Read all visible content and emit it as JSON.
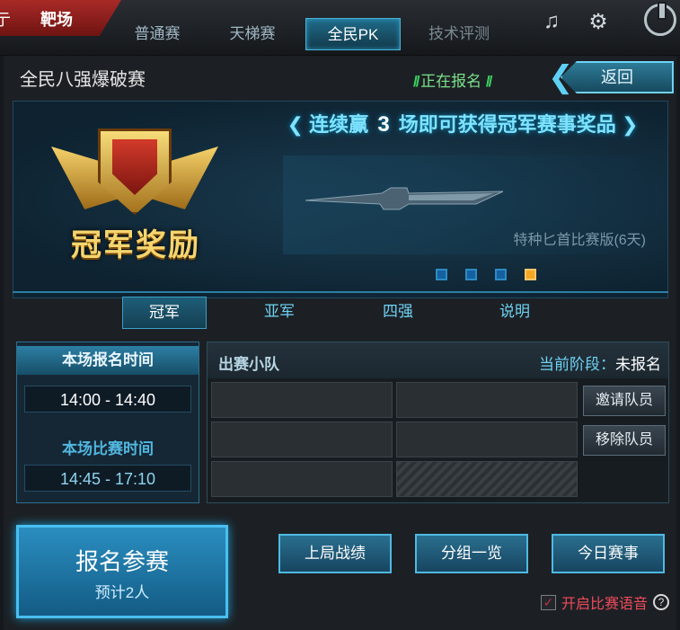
{
  "topbar": {
    "left_tab_partial": "亍",
    "red_tab": "靶场",
    "tabs": [
      {
        "label": "普通赛",
        "active": false
      },
      {
        "label": "天梯赛",
        "active": false
      },
      {
        "label": "全民PK",
        "active": true
      },
      {
        "label": "技术评测",
        "active": false
      }
    ],
    "icons": [
      "music-icon",
      "gear-icon",
      "power-icon"
    ]
  },
  "header": {
    "title": "全民八强爆破赛",
    "status": "正在报名",
    "back_label": "返回"
  },
  "banner": {
    "emblem_text": "冠军奖励",
    "headline_pre": "连续赢",
    "headline_num": "3",
    "headline_post": "场即可获得冠军赛事奖品",
    "prize_name": "特种匕首比赛版(6天)",
    "carousel_count": 4,
    "carousel_active_index": 3
  },
  "subtabs": [
    {
      "label": "冠军",
      "active": true
    },
    {
      "label": "亚军",
      "active": false
    },
    {
      "label": "四强",
      "active": false
    },
    {
      "label": "说明",
      "active": false
    }
  ],
  "times": {
    "signup_label": "本场报名时间",
    "signup_value": "14:00 - 14:40",
    "match_label": "本场比赛时间",
    "match_value": "14:45 - 17:10"
  },
  "team": {
    "title": "出赛小队",
    "stage_label": "当前阶段：",
    "stage_value": "未报名",
    "invite_label": "邀请队员",
    "remove_label": "移除队员"
  },
  "bottom": {
    "signup_main": "报名参赛",
    "signup_sub": "预计2人",
    "last_record": "上局战绩",
    "group_overview": "分组一览",
    "today_events": "今日赛事",
    "voice_label": "开启比赛语音",
    "voice_checked": true
  },
  "colors": {
    "accent": "#49bff0",
    "status_green": "#7be08a",
    "voice_red": "#f04a5a",
    "carousel_active": "#f5a623"
  }
}
